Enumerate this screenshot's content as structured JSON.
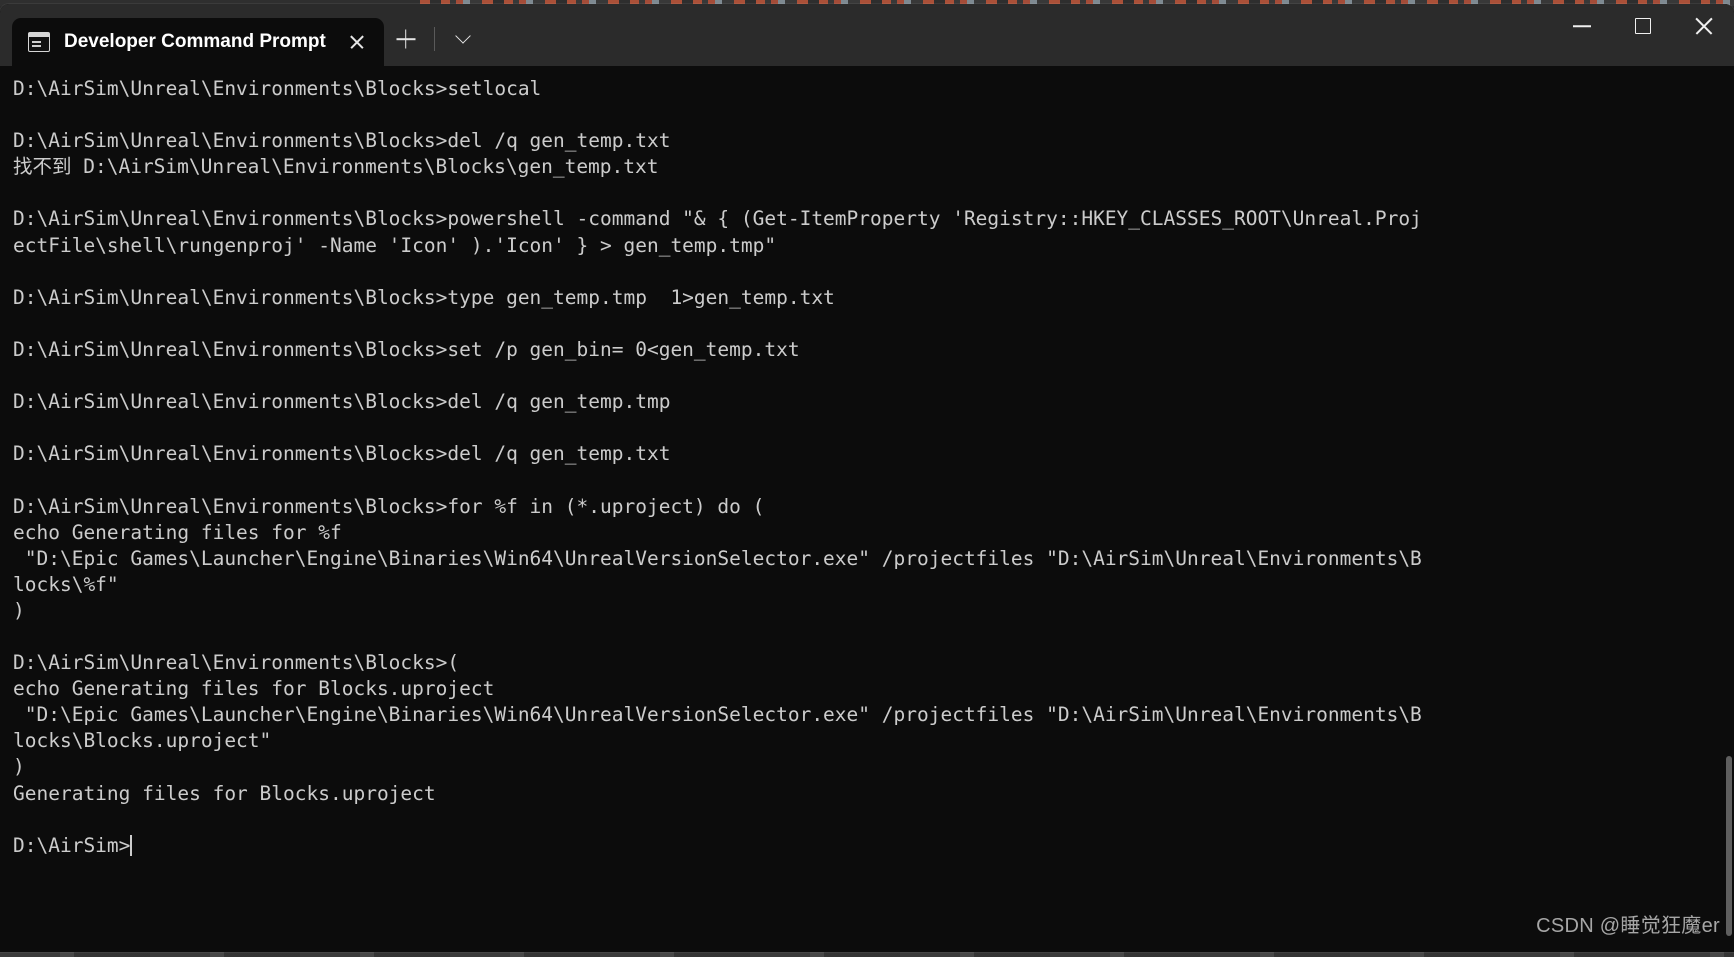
{
  "window": {
    "app_title": "Developer Command Prompt",
    "tab": {
      "label": "Developer Command Prompt",
      "icon": "console-window-icon",
      "close_label": "×"
    },
    "tab_actions": {
      "new_tab_label": "+",
      "dropdown_label": "⌄"
    },
    "controls": {
      "minimize_label": "—",
      "maximize_label": "□",
      "close_label": "✕"
    }
  },
  "terminal": {
    "prompt_path_blocks": "D:\\AirSim\\Unreal\\Environments\\Blocks>",
    "prompt_path_airsim": "D:\\AirSim>",
    "cursor_visible": true,
    "lines": [
      "D:\\AirSim\\Unreal\\Environments\\Blocks>setlocal",
      "",
      "D:\\AirSim\\Unreal\\Environments\\Blocks>del /q gen_temp.txt",
      "找不到 D:\\AirSim\\Unreal\\Environments\\Blocks\\gen_temp.txt",
      "",
      "D:\\AirSim\\Unreal\\Environments\\Blocks>powershell -command \"& { (Get-ItemProperty 'Registry::HKEY_CLASSES_ROOT\\Unreal.Proj",
      "ectFile\\shell\\rungenproj' -Name 'Icon' ).'Icon' } > gen_temp.tmp\"",
      "",
      "D:\\AirSim\\Unreal\\Environments\\Blocks>type gen_temp.tmp  1>gen_temp.txt",
      "",
      "D:\\AirSim\\Unreal\\Environments\\Blocks>set /p gen_bin= 0<gen_temp.txt",
      "",
      "D:\\AirSim\\Unreal\\Environments\\Blocks>del /q gen_temp.tmp",
      "",
      "D:\\AirSim\\Unreal\\Environments\\Blocks>del /q gen_temp.txt",
      "",
      "D:\\AirSim\\Unreal\\Environments\\Blocks>for %f in (*.uproject) do (",
      "echo Generating files for %f",
      " \"D:\\Epic Games\\Launcher\\Engine\\Binaries\\Win64\\UnrealVersionSelector.exe\" /projectfiles \"D:\\AirSim\\Unreal\\Environments\\B",
      "locks\\%f\"",
      ")",
      "",
      "D:\\AirSim\\Unreal\\Environments\\Blocks>(",
      "echo Generating files for Blocks.uproject",
      " \"D:\\Epic Games\\Launcher\\Engine\\Binaries\\Win64\\UnrealVersionSelector.exe\" /projectfiles \"D:\\AirSim\\Unreal\\Environments\\B",
      "locks\\Blocks.uproject\"",
      ")",
      "Generating files for Blocks.uproject",
      "",
      "D:\\AirSim>"
    ]
  },
  "watermark": {
    "text": "CSDN @睡觉狂魔er"
  },
  "colors": {
    "titlebar_bg": "#2b2b2b",
    "terminal_bg": "#0c0c0c",
    "terminal_fg": "#cccccc",
    "accent_orange": "#c0563a"
  }
}
